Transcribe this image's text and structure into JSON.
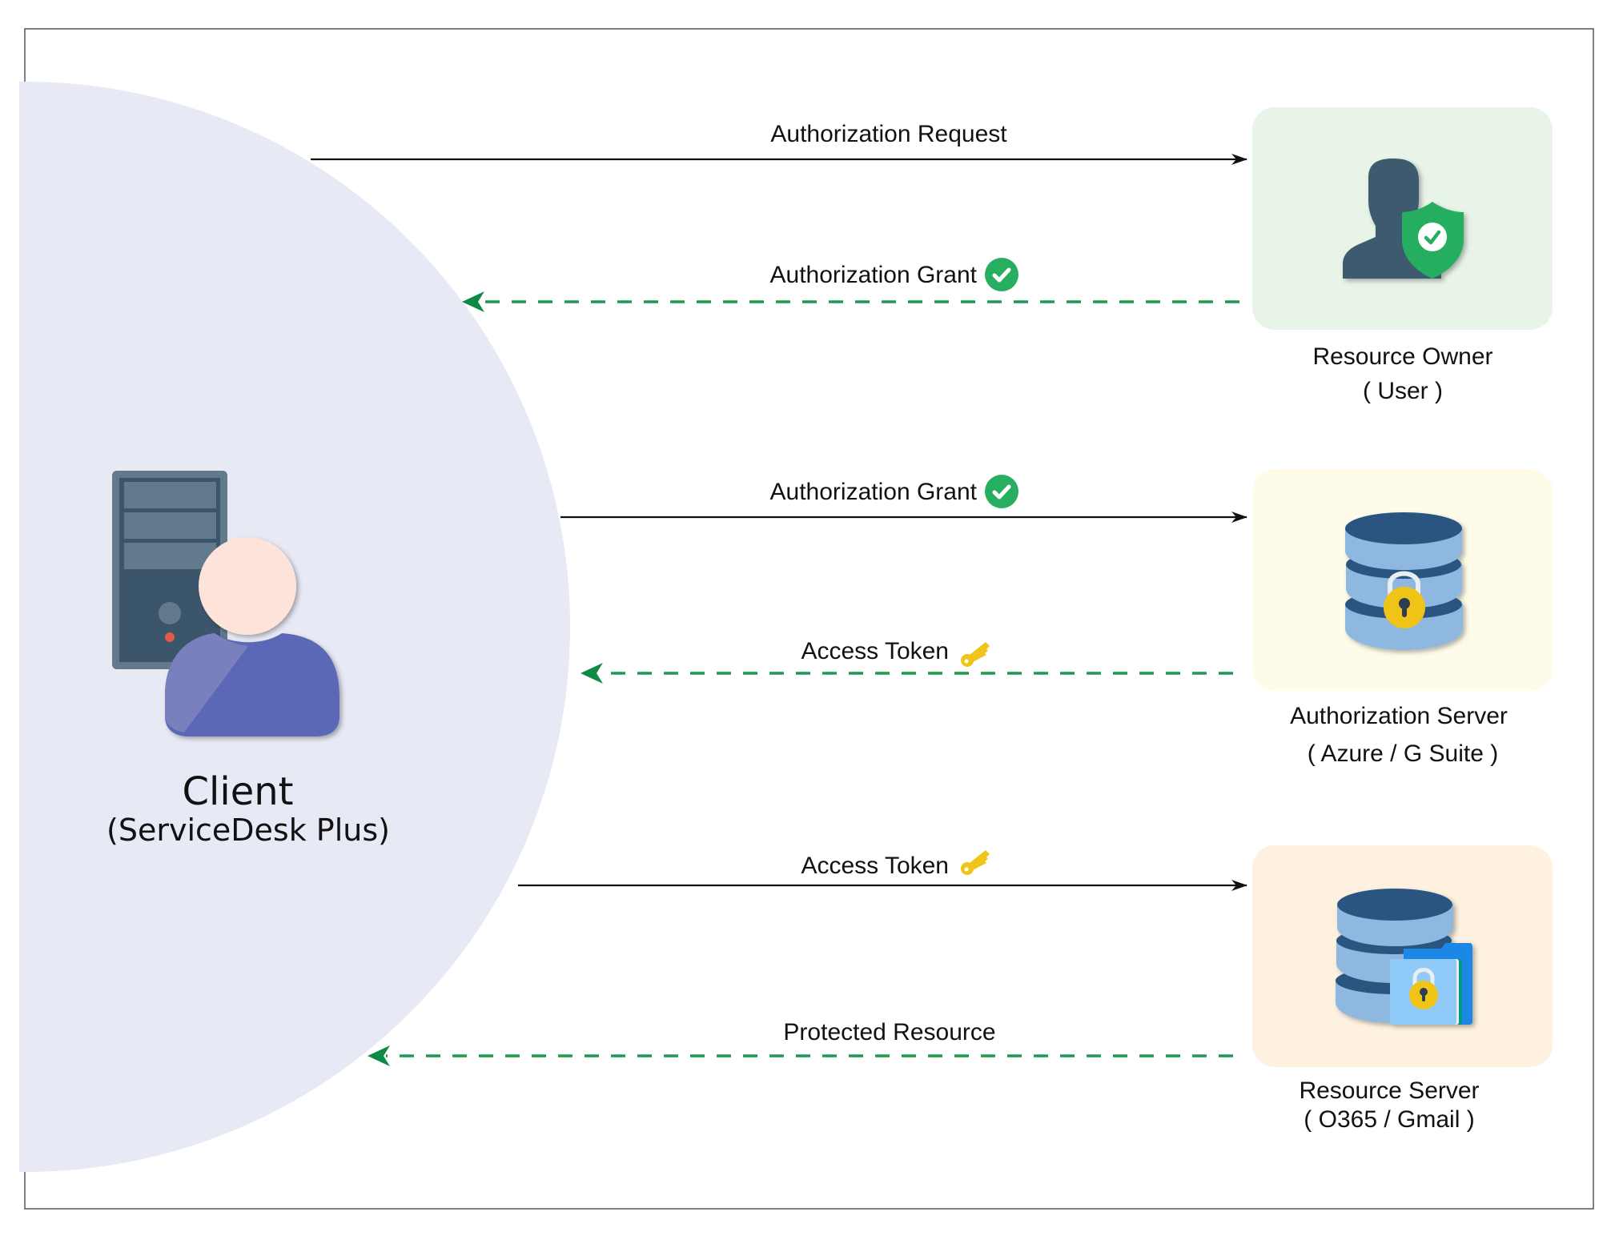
{
  "diagram": {
    "type": "oauth-flow",
    "colors": {
      "client_zone": "#e7e9f5",
      "request_arrow": "#111111",
      "response_arrow": "#1a9a4e",
      "check_badge": "#27ae60",
      "key": "#f0c419",
      "owner_box": "#e8f4e8",
      "auth_server_box": "#fefce9",
      "resource_server_box": "#fef1df"
    },
    "client": {
      "title": "Client",
      "subtitle": "(ServiceDesk Plus)",
      "icon": "server-with-user-icon"
    },
    "actors": [
      {
        "id": "resource-owner",
        "title": "Resource Owner",
        "subtitle": "( User )",
        "icon": "user-shield-icon"
      },
      {
        "id": "authorization-server",
        "title": "Authorization Server",
        "subtitle": "( Azure / G Suite )",
        "icon": "database-lock-icon"
      },
      {
        "id": "resource-server",
        "title": "Resource Server",
        "subtitle": "( O365 / Gmail )",
        "icon": "database-folder-lock-icon"
      }
    ],
    "flows": [
      {
        "label": "Authorization Request",
        "direction": "client-to-actor",
        "style": "solid",
        "badge": null
      },
      {
        "label": "Authorization Grant",
        "direction": "actor-to-client",
        "style": "dashed",
        "badge": "check-icon"
      },
      {
        "label": "Authorization Grant",
        "direction": "client-to-actor",
        "style": "solid",
        "badge": "check-icon"
      },
      {
        "label": "Access Token",
        "direction": "actor-to-client",
        "style": "dashed",
        "badge": "key-icon"
      },
      {
        "label": "Access Token",
        "direction": "client-to-actor",
        "style": "solid",
        "badge": "key-icon"
      },
      {
        "label": "Protected Resource",
        "direction": "actor-to-client",
        "style": "dashed",
        "badge": null
      }
    ]
  }
}
